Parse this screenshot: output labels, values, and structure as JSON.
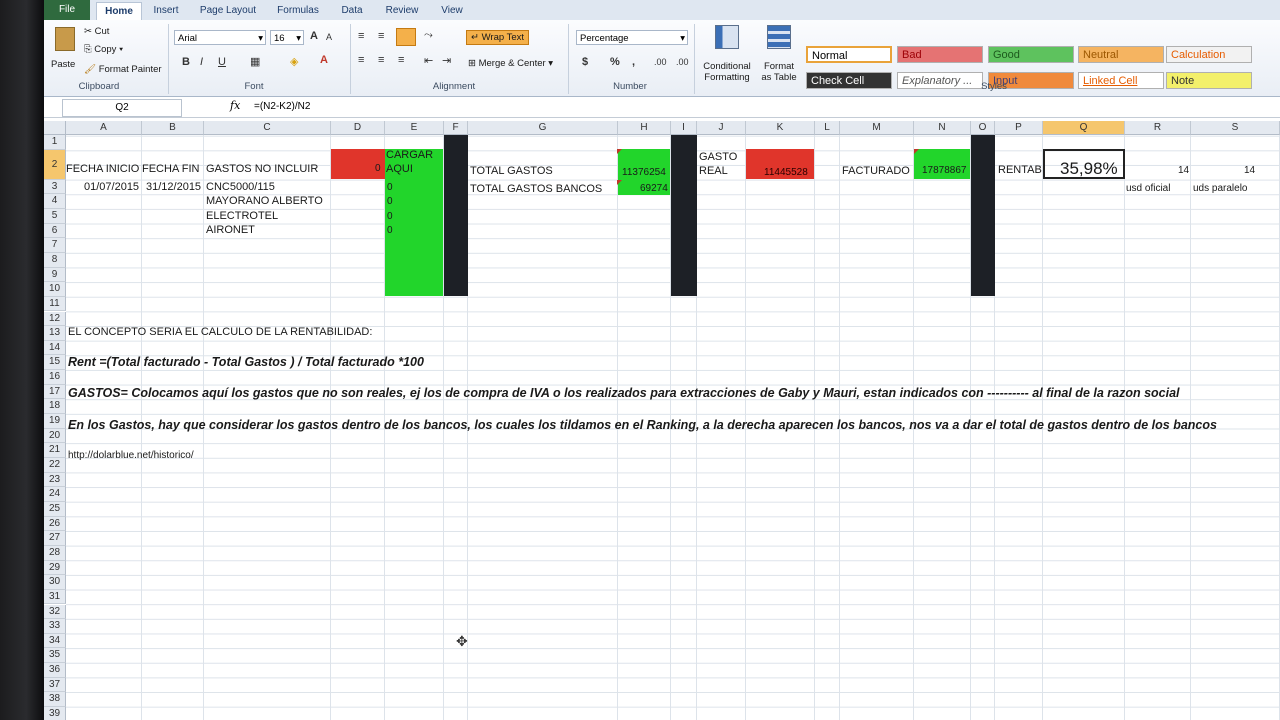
{
  "tabs": [
    "File",
    "Home",
    "Insert",
    "Page Layout",
    "Formulas",
    "Data",
    "Review",
    "View"
  ],
  "clipboard": {
    "paste": "Paste",
    "cut": "Cut",
    "copy": "Copy",
    "format_painter": "Format Painter",
    "label": "Clipboard"
  },
  "font": {
    "name": "Arial",
    "size": "16",
    "label": "Font",
    "bold": "B",
    "italic": "I",
    "underline": "U",
    "grow": "A",
    "shrink": "A"
  },
  "alignment": {
    "wrap_text": "Wrap Text",
    "merge_center": "Merge & Center",
    "label": "Alignment"
  },
  "number": {
    "format": "Percentage",
    "currency": "$",
    "percent": "%",
    "comma": ",",
    "inc_dec": ".00",
    "label": "Number"
  },
  "styles_group": {
    "conditional": "Conditional",
    "formatting": "Formatting",
    "format_as": "Format",
    "as_table": "as Table",
    "label": "Styles"
  },
  "styles": [
    {
      "name": "Normal",
      "bg": "#ffffff",
      "fg": "#000000"
    },
    {
      "name": "Bad",
      "bg": "#e57373",
      "fg": "#9c0006"
    },
    {
      "name": "Good",
      "bg": "#5ec25e",
      "fg": "#1d5a1d"
    },
    {
      "name": "Neutral",
      "bg": "#f5b461",
      "fg": "#9c5700"
    },
    {
      "name": "Calculation",
      "bg": "#f2f2f2",
      "fg": "#e65c00"
    },
    {
      "name": "Check Cell",
      "bg": "#333333",
      "fg": "#ffffff"
    },
    {
      "name": "Explanatory ...",
      "bg": "#ffffff",
      "fg": "#555555"
    },
    {
      "name": "Input",
      "bg": "#f08a3c",
      "fg": "#3f3f76"
    },
    {
      "name": "Linked Cell",
      "bg": "#ffffff",
      "fg": "#e65c00"
    },
    {
      "name": "Note",
      "bg": "#f3f06b",
      "fg": "#333333"
    }
  ],
  "formula_bar": {
    "name_box": "Q2",
    "fx": "fx",
    "formula": "=(N2-K2)/N2"
  },
  "columns": [
    "A",
    "B",
    "C",
    "D",
    "E",
    "F",
    "G",
    "H",
    "I",
    "J",
    "K",
    "L",
    "M",
    "N",
    "O",
    "P",
    "Q",
    "R",
    "S"
  ],
  "rows": [
    "1",
    "2",
    "3",
    "4",
    "5",
    "6",
    "7",
    "8",
    "9",
    "10",
    "11",
    "12",
    "13",
    "14",
    "15",
    "16",
    "17",
    "18",
    "19",
    "20",
    "21",
    "22",
    "23",
    "24",
    "25",
    "26",
    "27",
    "28",
    "29",
    "30",
    "31",
    "32",
    "33",
    "34",
    "35",
    "36",
    "37",
    "38",
    "39"
  ],
  "cells": {
    "a2": "FECHA INICIO",
    "b2": "FECHA FIN",
    "c2": "GASTOS NO INCLUIR",
    "d2": "0",
    "e2": "CARGAR AQUI",
    "g2": "TOTAL GASTOS",
    "h2": "11376254",
    "j2a": "GASTO",
    "j2b": "REAL",
    "k2": "11445528",
    "m2": "FACTURADO",
    "n2": "17878867",
    "p2": "RENTAB",
    "q2": "35,98%",
    "r2": "14",
    "s2": "14",
    "a3": "01/07/2015",
    "b3": "31/12/2015",
    "c3": "CNC5000/115",
    "e3": "0",
    "g3": "TOTAL GASTOS BANCOS",
    "h3": "69274",
    "r3": "usd oficial",
    "s3": "uds paralelo",
    "c4": "MAYORANO ALBERTO",
    "e4": "0",
    "c5": "ELECTROTEL",
    "e5": "0",
    "c6": "AIRONET",
    "e6": "0",
    "a13": "EL CONCEPTO SERIA EL CALCULO DE LA RENTABILIDAD:",
    "a15": "Rent =(Total facturado - Total Gastos ) / Total facturado *100",
    "a17": "GASTOS= Colocamos aquí los gastos que no son reales, ej los de compra de IVA o los realizados para extracciones de Gaby y Mauri, estan indicados con ---------- al final de la razon social",
    "a19": "En los Gastos, hay que considerar los gastos dentro de los bancos, los cuales los tildamos en el Ranking, a la derecha aparecen los bancos, nos va a dar el total de gastos dentro de los bancos",
    "a21": "http://dolarblue.net/historico/"
  }
}
